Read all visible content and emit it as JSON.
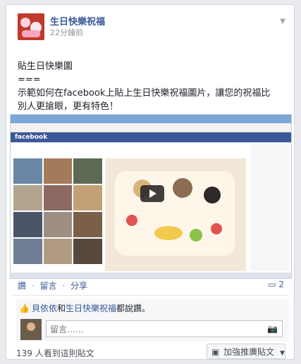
{
  "post": {
    "page_name": "生日快樂祝福",
    "timestamp": "22分鐘前",
    "text_lines": [
      "貼生日快樂圖",
      "===",
      "示範如何在facebook上貼上生日快樂祝福圖片，讓您的祝福比",
      "別人更搶眼，更有特色！"
    ]
  },
  "actions": {
    "like": "讚",
    "comment": "留言",
    "share": "分享",
    "separator": "·",
    "comment_count": "2"
  },
  "likes": {
    "names": "貝依依",
    "and": "和",
    "page": "生日快樂祝福",
    "suffix": "都說讚。"
  },
  "comment": {
    "placeholder": "留言……"
  },
  "footer": {
    "seen": "139 人看到這則貼文",
    "boost": "加強推廣貼文"
  },
  "screenshot": {
    "logo": "facebook"
  },
  "colors": {
    "link": "#365899",
    "brand": "#3b5998"
  }
}
